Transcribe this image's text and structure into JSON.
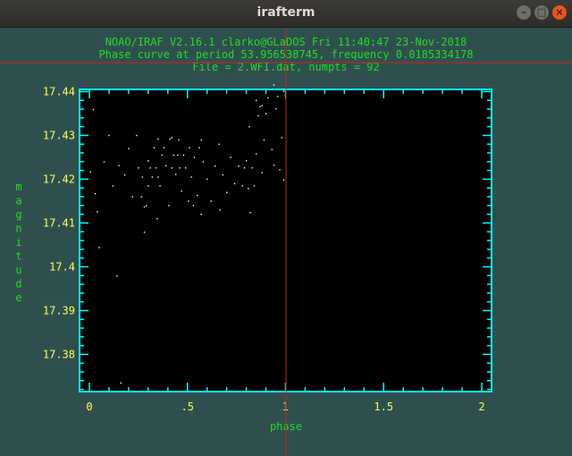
{
  "window": {
    "title": "irafterm",
    "buttons": {
      "minimize": "–",
      "maximize": "□",
      "close": "×"
    }
  },
  "colors": {
    "background": "#2f4f4f",
    "plot_bg": "#000000",
    "axes": "#00ffff",
    "header_text": "#22dd22",
    "tick_labels": "#ffff55",
    "points": "#ffffff",
    "cursor": "#cc2222"
  },
  "chart_data": {
    "type": "scatter",
    "header": [
      "NOAO/IRAF V2.16.1 clarko@GLaDOS Fri 11:40:47 23-Nov-2018",
      "Phase curve at period 53.956538745, frequency 0.0185334178",
      "File = 2.WFI.dat, numpts = 92"
    ],
    "xlabel": "phase",
    "ylabel": "magnitude",
    "xlim": [
      -0.05,
      2.05
    ],
    "ylim": [
      17.4405,
      17.3715
    ],
    "x_ticks": [
      0,
      0.5,
      1,
      1.5,
      2
    ],
    "x_tick_labels": [
      "0",
      ".5",
      "1",
      "1.5",
      "2"
    ],
    "y_ticks": [
      17.44,
      17.43,
      17.42,
      17.41,
      17.4,
      17.39,
      17.38
    ],
    "y_tick_labels": [
      "17.44",
      "17.43",
      "17.42",
      "17.41",
      "17.4",
      "17.39",
      "17.38"
    ],
    "cursor": {
      "x": 1.0,
      "y": 17.4466
    },
    "points": [
      [
        0.005,
        17.4217
      ],
      [
        0.02,
        17.4359
      ],
      [
        0.03,
        17.4167
      ],
      [
        0.04,
        17.4126
      ],
      [
        0.05,
        17.4044
      ],
      [
        0.14,
        17.3979
      ],
      [
        0.15,
        17.4231
      ],
      [
        0.16,
        17.3735
      ],
      [
        0.25,
        17.4226
      ],
      [
        0.27,
        17.4205
      ],
      [
        0.28,
        17.4137
      ],
      [
        0.28,
        17.4079
      ],
      [
        0.29,
        17.414
      ],
      [
        0.3,
        17.4242
      ],
      [
        0.3,
        17.4185
      ],
      [
        0.31,
        17.4226
      ],
      [
        0.32,
        17.4205
      ],
      [
        0.33,
        17.4272
      ],
      [
        0.34,
        17.4226
      ],
      [
        0.35,
        17.4205
      ],
      [
        0.35,
        17.4292
      ],
      [
        0.36,
        17.4185
      ],
      [
        0.37,
        17.4255
      ],
      [
        0.38,
        17.4272
      ],
      [
        0.39,
        17.4231
      ],
      [
        0.41,
        17.4292
      ],
      [
        0.42,
        17.4226
      ],
      [
        0.42,
        17.4295
      ],
      [
        0.43,
        17.4255
      ],
      [
        0.44,
        17.4211
      ],
      [
        0.45,
        17.4255
      ],
      [
        0.46,
        17.4226
      ],
      [
        0.47,
        17.4173
      ],
      [
        0.48,
        17.4255
      ],
      [
        0.49,
        17.4226
      ],
      [
        0.51,
        17.4272
      ],
      [
        0.52,
        17.4205
      ],
      [
        0.53,
        17.414
      ],
      [
        0.55,
        17.4163
      ],
      [
        0.56,
        17.4272
      ],
      [
        0.57,
        17.412
      ],
      [
        0.57,
        17.429
      ],
      [
        0.78,
        17.4185
      ],
      [
        0.79,
        17.4226
      ],
      [
        0.8,
        17.4242
      ],
      [
        0.81,
        17.4179
      ],
      [
        0.82,
        17.4124
      ],
      [
        0.83,
        17.4226
      ],
      [
        0.84,
        17.4185
      ],
      [
        0.85,
        17.4258
      ],
      [
        0.85,
        17.438
      ],
      [
        0.86,
        17.4345
      ],
      [
        0.87,
        17.4366
      ],
      [
        0.88,
        17.4215
      ],
      [
        0.88,
        17.4368
      ],
      [
        0.89,
        17.429
      ],
      [
        0.9,
        17.435
      ],
      [
        0.91,
        17.4386
      ],
      [
        0.93,
        17.4268
      ],
      [
        0.94,
        17.4232
      ],
      [
        0.94,
        17.4415
      ],
      [
        0.95,
        17.4361
      ],
      [
        0.96,
        17.4389
      ],
      [
        0.97,
        17.4222
      ],
      [
        0.98,
        17.4295
      ],
      [
        0.99,
        17.4401
      ],
      [
        0.99,
        17.4199
      ],
      [
        0.075,
        17.424
      ],
      [
        0.1,
        17.43
      ],
      [
        0.12,
        17.4185
      ],
      [
        0.18,
        17.421
      ],
      [
        0.2,
        17.427
      ],
      [
        0.22,
        17.416
      ],
      [
        0.58,
        17.424
      ],
      [
        0.6,
        17.42
      ],
      [
        0.62,
        17.415
      ],
      [
        0.64,
        17.423
      ],
      [
        0.66,
        17.428
      ],
      [
        0.68,
        17.421
      ],
      [
        0.7,
        17.417
      ],
      [
        0.72,
        17.425
      ],
      [
        0.74,
        17.419
      ],
      [
        0.76,
        17.423
      ],
      [
        0.24,
        17.43
      ],
      [
        0.265,
        17.416
      ],
      [
        0.345,
        17.411
      ],
      [
        0.405,
        17.414
      ],
      [
        0.455,
        17.429
      ],
      [
        0.505,
        17.415
      ],
      [
        0.535,
        17.425
      ],
      [
        0.665,
        17.413
      ],
      [
        0.815,
        17.432
      ]
    ]
  }
}
